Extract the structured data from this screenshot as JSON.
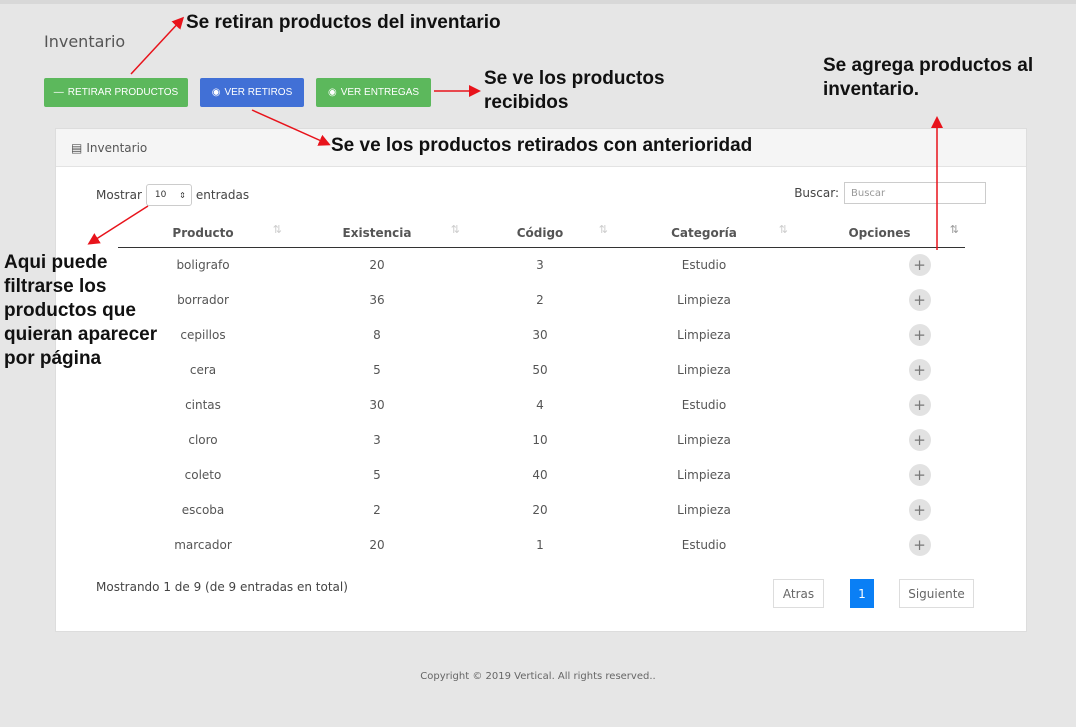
{
  "page": {
    "title": "Inventario"
  },
  "toolbar": {
    "retirar_label": "RETIRAR PRODUCTOS",
    "retirar_icon": "minus-icon",
    "retiros_label": "VER RETIROS",
    "retiros_icon": "eye-icon",
    "entregas_label": "VER ENTREGAS",
    "entregas_icon": "eye-icon",
    "green": "#5cb85c",
    "blue": "#4170d6"
  },
  "panel": {
    "title": "Inventario",
    "icon": "list-icon",
    "show_label": "Mostrar",
    "show_value": "10",
    "show_suffix": "entradas",
    "search_label": "Buscar:",
    "search_placeholder": "Buscar"
  },
  "table": {
    "headers": [
      "Producto",
      "Existencia",
      "Código",
      "Categoría",
      "Opciones"
    ],
    "rows": [
      [
        "boligrafo",
        "20",
        "3",
        "Estudio"
      ],
      [
        "borrador",
        "36",
        "2",
        "Limpieza"
      ],
      [
        "cepillos",
        "8",
        "30",
        "Limpieza"
      ],
      [
        "cera",
        "5",
        "50",
        "Limpieza"
      ],
      [
        "cintas",
        "30",
        "4",
        "Estudio"
      ],
      [
        "cloro",
        "3",
        "10",
        "Limpieza"
      ],
      [
        "coleto",
        "5",
        "40",
        "Limpieza"
      ],
      [
        "escoba",
        "2",
        "20",
        "Limpieza"
      ],
      [
        "marcador",
        "20",
        "1",
        "Estudio"
      ]
    ]
  },
  "pagination": {
    "info": "Mostrando 1 de 9 (de 9 entradas en total)",
    "prev": "Atras",
    "current": "1",
    "next": "Siguiente",
    "active_color": "#0a7ff5"
  },
  "footer": {
    "copyright": "Copyright © 2019 Vertical. All rights reserved.."
  },
  "annotations": {
    "retiran": "Se retiran productos del inventario",
    "recibidos_1": "Se ve los productos",
    "recibidos_2": "recibidos",
    "agrega_1": "Se agrega productos al",
    "agrega_2": "inventario.",
    "retirados": "Se ve los productos retirados con anterioridad",
    "filtrar": [
      "Aqui puede",
      "filtrarse los",
      "productos que",
      "quieran aparecer",
      "por página"
    ],
    "arrow_color": "#e8131b"
  }
}
